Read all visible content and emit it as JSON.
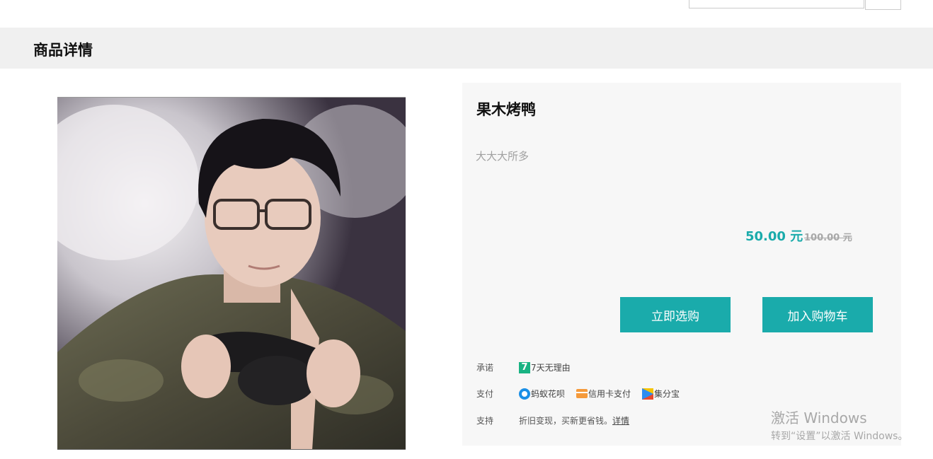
{
  "header": {
    "title": "商品详情"
  },
  "product": {
    "name": "果木烤鸭",
    "description": "大大大所多",
    "price_now": "50.00 元",
    "price_old": "100.00 元"
  },
  "actions": {
    "buy_now": "立即选购",
    "add_to_cart": "加入购物车"
  },
  "services": {
    "promise_label": "承诺",
    "promise_icon": "7",
    "promise_text": "7天无理由",
    "payment_label": "支付",
    "payment_methods": [
      "蚂蚁花呗",
      "信用卡支付",
      "集分宝"
    ],
    "support_label": "支持",
    "support_text": "折旧变现，买新更省钱。",
    "support_link": "详情"
  },
  "watermark": {
    "line1": "激活 Windows",
    "line2": "转到“设置”以激活 Windows。"
  },
  "colors": {
    "accent": "#1aabab",
    "header_bg": "#f0f0f0",
    "panel_bg": "#f7f7f7"
  }
}
